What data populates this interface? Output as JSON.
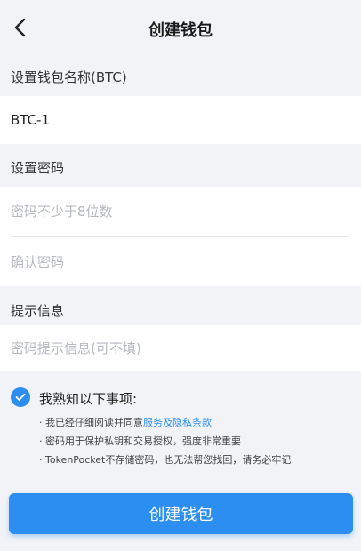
{
  "header": {
    "title": "创建钱包"
  },
  "wallet_name": {
    "label": "设置钱包名称(BTC)",
    "value": "BTC-1"
  },
  "password": {
    "label": "设置密码",
    "placeholder": "密码不少于8位数",
    "confirm_placeholder": "确认密码"
  },
  "hint": {
    "label": "提示信息",
    "placeholder": "密码提示信息(可不填)"
  },
  "agreement": {
    "checked": true,
    "title": "我熟知以下事项:",
    "line1_prefix": "· 我已经仔细阅读并同意",
    "line1_link": "服务及隐私条款",
    "line2": "· 密码用于保护私钥和交易授权，强度非常重要",
    "line3": "· TokenPocket不存储密码，也无法帮您找回，请务必牢记"
  },
  "submit": {
    "label": "创建钱包"
  },
  "colors": {
    "accent": "#2b8ef0",
    "background": "#f2f3f7",
    "placeholder": "#b5b8bf"
  }
}
